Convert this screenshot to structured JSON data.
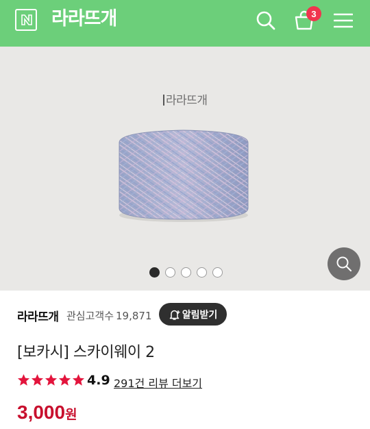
{
  "header": {
    "logo_icon": "naver-n-icon",
    "shop_title": "라라뜨개",
    "search_icon": "search-icon",
    "cart_icon": "shopping-bag-icon",
    "cart_count": "3",
    "menu_icon": "hamburger-menu-icon",
    "background_color": "#6ccf7a"
  },
  "gallery": {
    "watermark": "라라뜨개",
    "image_count": 5,
    "active_index": 0,
    "zoom_icon": "zoom-search-icon"
  },
  "store": {
    "name": "라라뜨개",
    "followers_label": "관심고객수",
    "followers_count": "19,871",
    "follow_button_label": "알림받기",
    "follow_icon": "bell-plus-icon"
  },
  "product": {
    "title": "[보카시] 스카이웨이 2",
    "rating": "4.9",
    "stars_filled": 5,
    "review_link": "291건 리뷰 더보기",
    "price": "3,000",
    "price_unit": "원",
    "price_color": "#c8102e"
  }
}
